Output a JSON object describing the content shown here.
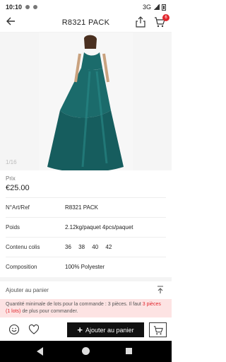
{
  "status": {
    "time": "10:10",
    "network": "3G"
  },
  "header": {
    "title": "R8321 PACK",
    "cart_count": "6"
  },
  "gallery": {
    "counter": "1/16"
  },
  "price": {
    "label": "Prix",
    "value": "€25.00"
  },
  "specs": [
    {
      "label": "N°Art/Ref",
      "value": "R8321 PACK"
    },
    {
      "label": "Poids",
      "value": "2.12kg/paquet 4pcs/paquet"
    },
    {
      "label": "Contenu colis",
      "sizes": [
        "36",
        "38",
        "40",
        "42"
      ]
    },
    {
      "label": "Composition",
      "value": "100% Polyester"
    }
  ],
  "add": {
    "label": "Ajouter au panier"
  },
  "notice": {
    "part1": "Quantité minimale de lots pour la commande : 3 pièces. Il faut ",
    "highlight": "3 pièces (1 lots)",
    "part2": " de plus pour commander."
  },
  "bottom": {
    "add_button": "Ajouter au panier"
  },
  "colors": {
    "accent": "#e1262d",
    "dress": "#1b6b6b",
    "notice_bg": "#fde3e3"
  }
}
